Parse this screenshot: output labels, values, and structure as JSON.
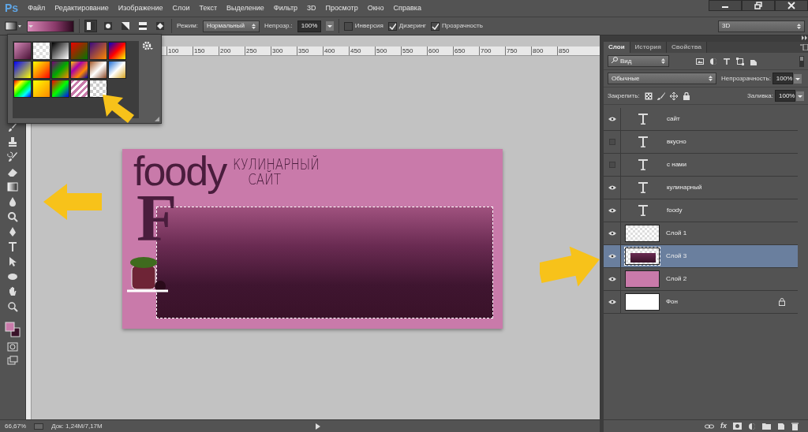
{
  "menu_bar": {
    "logo": "Ps",
    "items": [
      "Файл",
      "Редактирование",
      "Изображение",
      "Слои",
      "Текст",
      "Выделение",
      "Фильтр",
      "3D",
      "Просмотр",
      "Окно",
      "Справка"
    ]
  },
  "options_bar": {
    "gradient_types": [
      {
        "kind": "linear",
        "selected": true
      },
      {
        "kind": "radial",
        "selected": false
      },
      {
        "kind": "angle",
        "selected": false
      },
      {
        "kind": "reflected",
        "selected": false
      },
      {
        "kind": "diamond",
        "selected": false
      }
    ],
    "mode_label": "Режим:",
    "mode": "Нормальный",
    "opacity_label": "Непрозр.:",
    "opacity": "100%",
    "checkboxes": [
      {
        "label": "Инверсия",
        "checked": false
      },
      {
        "label": "Дизеринг",
        "checked": true
      },
      {
        "label": "Прозрачность",
        "checked": true
      }
    ],
    "workspace": "3D"
  },
  "ruler": {
    "ticks": [
      "100",
      "150",
      "200",
      "250",
      "300",
      "350",
      "400",
      "450",
      "500",
      "550",
      "600",
      "650",
      "700",
      "750",
      "800",
      "850"
    ]
  },
  "document": {
    "title": "foody",
    "subtitle_lines": [
      "КУЛИНАРНЫЙ",
      "САЙТ"
    ],
    "initial": "F"
  },
  "layers_panel": {
    "tabs": [
      {
        "label": "Слои",
        "selected": true
      },
      {
        "label": "История",
        "selected": false
      },
      {
        "label": "Свойства",
        "selected": false
      }
    ],
    "filter": "Вид",
    "blend_mode": "Обычные",
    "opacity_label": "Непрозрачность:",
    "opacity": "100%",
    "lock_label": "Закрепить:",
    "fill_label": "Заливка:",
    "fill": "100%",
    "layers": [
      {
        "name": "сайт",
        "kind": "text",
        "visible": true,
        "selected": false,
        "locked": false
      },
      {
        "name": "вкусно",
        "kind": "text",
        "visible": false,
        "selected": false,
        "locked": false
      },
      {
        "name": "с нами",
        "kind": "text",
        "visible": false,
        "selected": false,
        "locked": false
      },
      {
        "name": "кулинарный",
        "kind": "text",
        "visible": true,
        "selected": false,
        "locked": false
      },
      {
        "name": "foody",
        "kind": "text",
        "visible": true,
        "selected": false,
        "locked": false
      },
      {
        "name": "Слой 1",
        "kind": "sprite",
        "visible": true,
        "selected": false,
        "locked": false
      },
      {
        "name": "Слой 3",
        "kind": "gradient",
        "visible": true,
        "selected": true,
        "locked": false
      },
      {
        "name": "Слой 2",
        "kind": "fill",
        "color": "#c97aaa",
        "visible": true,
        "selected": false,
        "locked": false
      },
      {
        "name": "Фон",
        "kind": "fill",
        "color": "#ffffff",
        "visible": true,
        "selected": false,
        "locked": true
      }
    ],
    "effects_button": "fx"
  },
  "status_bar": {
    "zoom": "66,67%",
    "doc_size": "Док: 1,24M/7,17M"
  }
}
